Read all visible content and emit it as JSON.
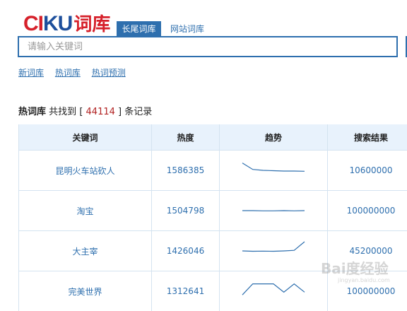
{
  "logo": {
    "part1": "CI",
    "part2": "KU",
    "chinese": "词库"
  },
  "tabs": [
    {
      "label": "长尾词库",
      "active": true
    },
    {
      "label": "网站词库",
      "active": false
    }
  ],
  "search": {
    "placeholder": "请输入关键词",
    "value": ""
  },
  "sublinks": [
    "新词库",
    "热词库",
    "热词预测"
  ],
  "result": {
    "category": "热词库",
    "prefix": "共找到",
    "bracket_open": "[",
    "count": "44114",
    "bracket_close": "]",
    "suffix": "条记录"
  },
  "table": {
    "headers": [
      "关键词",
      "热度",
      "趋势",
      "搜索结果"
    ],
    "rows": [
      {
        "keyword": "昆明火车站砍人",
        "heat": "1586385",
        "trend": [
          0.9,
          0.55,
          0.5,
          0.48,
          0.46,
          0.46,
          0.45
        ],
        "results": "10600000"
      },
      {
        "keyword": "淘宝",
        "heat": "1504798",
        "trend": [
          0.5,
          0.5,
          0.49,
          0.49,
          0.5,
          0.49,
          0.5
        ],
        "results": "100000000"
      },
      {
        "keyword": "大主宰",
        "heat": "1426046",
        "trend": [
          0.5,
          0.48,
          0.49,
          0.48,
          0.5,
          0.53,
          1.0
        ],
        "results": "45200000"
      },
      {
        "keyword": "完美世界",
        "heat": "1312641",
        "trend": [
          0.3,
          0.9,
          0.9,
          0.9,
          0.45,
          0.9,
          0.45
        ],
        "results": "100000000"
      }
    ]
  },
  "colors": {
    "brand_red": "#d6202a",
    "brand_blue": "#1d4f9c",
    "accent": "#2e6fae",
    "header_bg": "#e8f2fc"
  },
  "watermark": {
    "main": "Bai度经验",
    "sub": "jingyan.baidu.com"
  }
}
